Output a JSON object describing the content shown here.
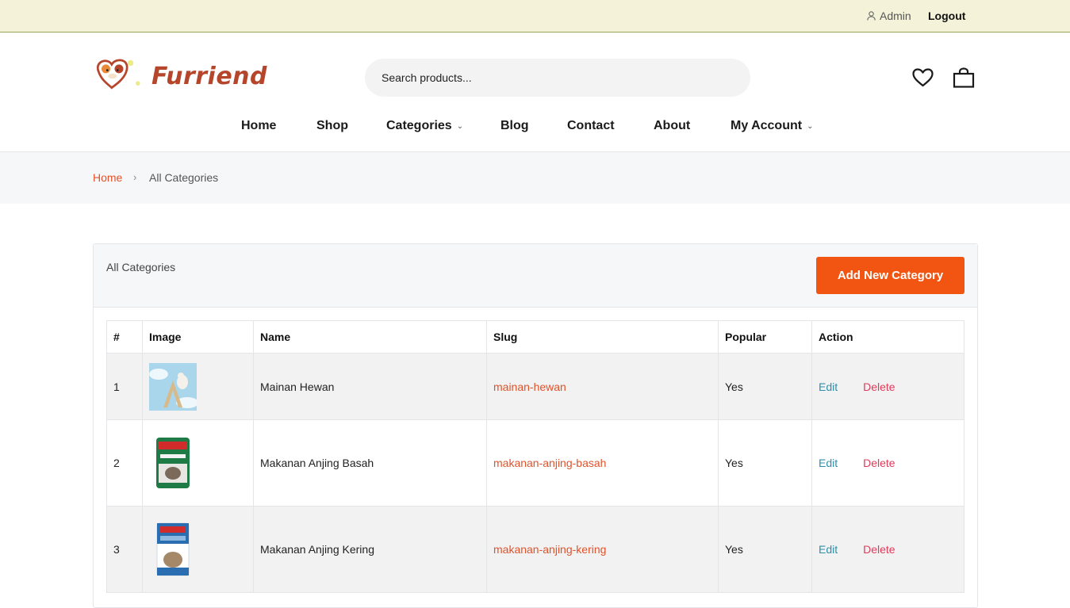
{
  "topbar": {
    "admin_label": "Admin",
    "logout_label": "Logout"
  },
  "brand": {
    "name": "Furriend"
  },
  "search": {
    "placeholder": "Search products..."
  },
  "nav": {
    "home": "Home",
    "shop": "Shop",
    "categories": "Categories",
    "blog": "Blog",
    "contact": "Contact",
    "about": "About",
    "my_account": "My Account"
  },
  "breadcrumb": {
    "home": "Home",
    "separator": "›",
    "current": "All Categories"
  },
  "panel": {
    "title": "All Categories",
    "add_button": "Add New Category"
  },
  "table": {
    "headers": {
      "num": "#",
      "image": "Image",
      "name": "Name",
      "slug": "Slug",
      "popular": "Popular",
      "action": "Action"
    },
    "rows": [
      {
        "num": "1",
        "name": "Mainan Hewan",
        "slug": "mainan-hewan",
        "popular": "Yes",
        "edit": "Edit",
        "delete": "Delete"
      },
      {
        "num": "2",
        "name": "Makanan Anjing Basah",
        "slug": "makanan-anjing-basah",
        "popular": "Yes",
        "edit": "Edit",
        "delete": "Delete"
      },
      {
        "num": "3",
        "name": "Makanan Anjing Kering",
        "slug": "makanan-anjing-kering",
        "popular": "Yes",
        "edit": "Edit",
        "delete": "Delete"
      }
    ]
  },
  "colors": {
    "accent": "#f25511",
    "link_orange": "#e0522a",
    "edit_blue": "#2e8fa8",
    "delete_red": "#e03b5a",
    "topbar_bg": "#f4f3d9",
    "brand": "#b5462c"
  },
  "icons": {
    "user": "user-icon",
    "heart": "heart-icon",
    "bag": "shopping-bag-icon",
    "caret": "chevron-down-icon"
  }
}
